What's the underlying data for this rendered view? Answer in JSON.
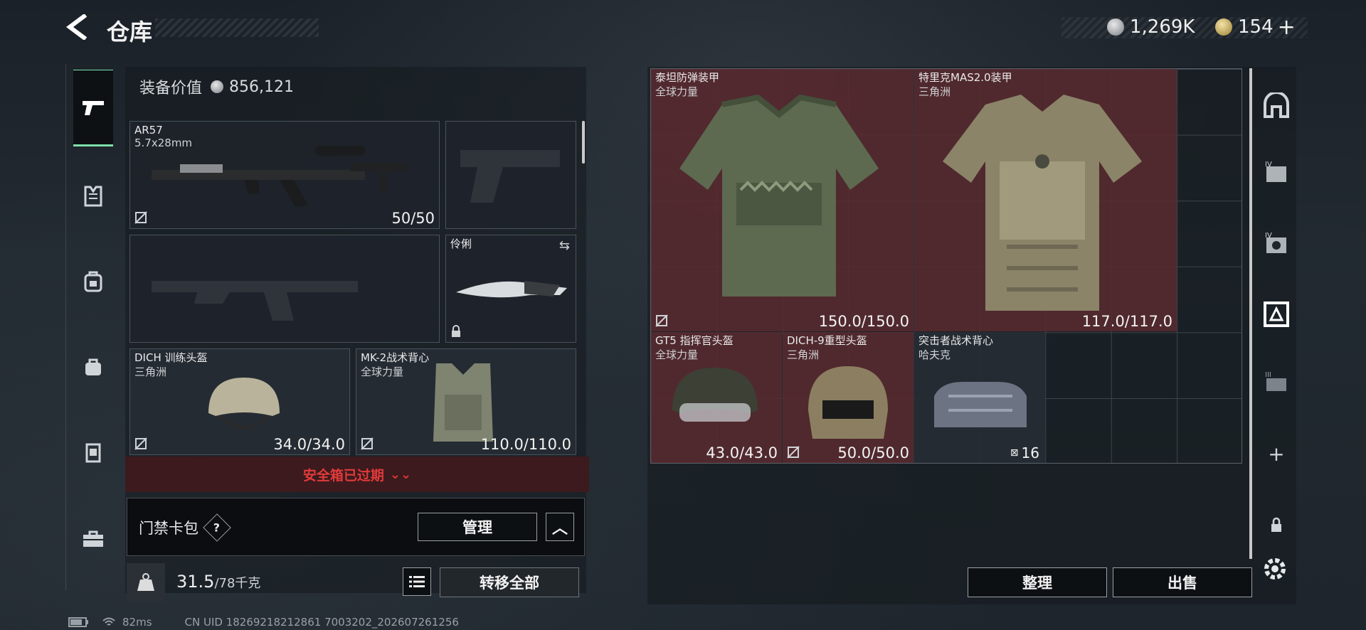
{
  "header": {
    "back_glyph": "‹",
    "title": "仓库",
    "currency_silver": "1,269K",
    "currency_gold": "154",
    "add_glyph": "+"
  },
  "nav_icons": [
    "pistol-icon",
    "armor-icon",
    "backpack-icon",
    "bag-icon",
    "chest-rig-icon",
    "case-icon"
  ],
  "equipment": {
    "value_label": "装备价值",
    "value": "856,121"
  },
  "slots": {
    "primary": {
      "name": "AR57",
      "sub": "5.7x28mm",
      "durability": "50/50"
    },
    "knife": {
      "name": "伶俐"
    },
    "helmet": {
      "name": "DICH 训练头盔",
      "sub": "三角洲",
      "durability": "34.0/34.0"
    },
    "vest": {
      "name": "MK-2战术背心",
      "sub": "全球力量",
      "durability": "110.0/110.0"
    }
  },
  "secure_case": {
    "expired_text": "安全箱已过期",
    "chevron": "⌄⌄"
  },
  "card_pack": {
    "label": "门禁卡包",
    "help": "?",
    "manage": "管理",
    "collapse": "︿"
  },
  "weight": {
    "current": "31.5",
    "max": "/78千克",
    "transfer_all": "转移全部",
    "list_icon": "≡"
  },
  "storage_items": [
    {
      "name": "泰坦防弹装甲",
      "sub": "全球力量",
      "durability": "150.0/150.0"
    },
    {
      "name": "特里克MAS2.0装甲",
      "sub": "三角洲",
      "durability": "117.0/117.0"
    },
    {
      "name": "GT5 指挥官头盔",
      "sub": "全球力量",
      "durability": "43.0/43.0"
    },
    {
      "name": "DICH-9重型头盔",
      "sub": "三角洲",
      "durability": "50.0/50.0"
    },
    {
      "name": "突击者战术背心",
      "sub": "哈夫克",
      "durability": "16"
    }
  ],
  "actions": {
    "sort": "整理",
    "sell": "出售"
  },
  "right_nav": {
    "plus": "+",
    "lock": "🔒",
    "gear": "⚙"
  },
  "status_bar": {
    "ping": "82ms",
    "uid": "CN UID 18269218212861 7003202_202607261256"
  },
  "colors": {
    "accent_green": "#7fe0a8",
    "expired_red": "#e23a3a",
    "maroon_slot": "#562a30"
  }
}
